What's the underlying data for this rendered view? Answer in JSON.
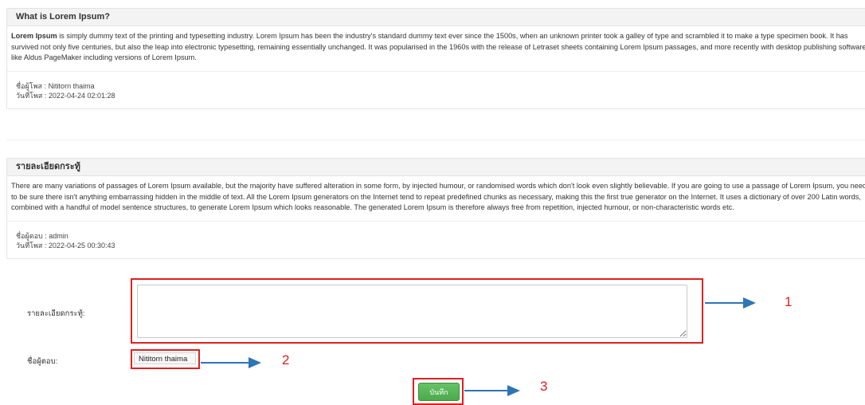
{
  "topic": {
    "title": "What is Lorem Ipsum?",
    "body_bold": "Lorem Ipsum",
    "body": " is simply dummy text of the printing and typesetting industry. Lorem Ipsum has been the industry's standard dummy text ever since the 1500s, when an unknown printer took a galley of type and scrambled it to make a type specimen book. It has survived not only five centuries, but also the leap into electronic typesetting, remaining essentially unchanged. It was popularised in the 1960s with the release of Letraset sheets containing Lorem Ipsum passages, and more recently with desktop publishing software like Aldus PageMaker including versions of Lorem Ipsum.",
    "poster_label": "ชื่อผู้โพส",
    "poster_name": "Nititorn thaima",
    "date_label": "วันที่โพส",
    "date": "2022-04-24 02:01:28"
  },
  "reply": {
    "title": "รายละเอียดกระทู้",
    "body": "There are many variations of passages of Lorem Ipsum available, but the majority have suffered alteration in some form, by injected humour, or randomised words which don't look even slightly believable. If you are going to use a passage of Lorem Ipsum, you need to be sure there isn't anything embarrassing hidden in the middle of text. All the Lorem Ipsum generators on the Internet tend to repeat predefined chunks as necessary, making this the first true generator on the Internet. It uses a dictionary of over 200 Latin words, combined with a handful of model sentence structures, to generate Lorem Ipsum which looks reasonable. The generated Lorem Ipsum is therefore always free from repetition, injected humour, or non-characteristic words etc.",
    "replier_label": "ชื่อผู้ตอบ",
    "replier_name": "admin",
    "date_label": "วันที่โพส",
    "date": "2022-04-25 00:30:43"
  },
  "form": {
    "detail_label": "รายละเอียดกระทู้:",
    "detail_value": "",
    "name_label": "ชื่อผู้ตอบ:",
    "name_value": "Nititorn thaima",
    "save_label": "บันทึก"
  },
  "annotations": [
    "1",
    "2",
    "3"
  ],
  "colors": {
    "annotation_box": "#e02020",
    "arrow": "#2e75b6",
    "save_button": "#5cb85c"
  }
}
